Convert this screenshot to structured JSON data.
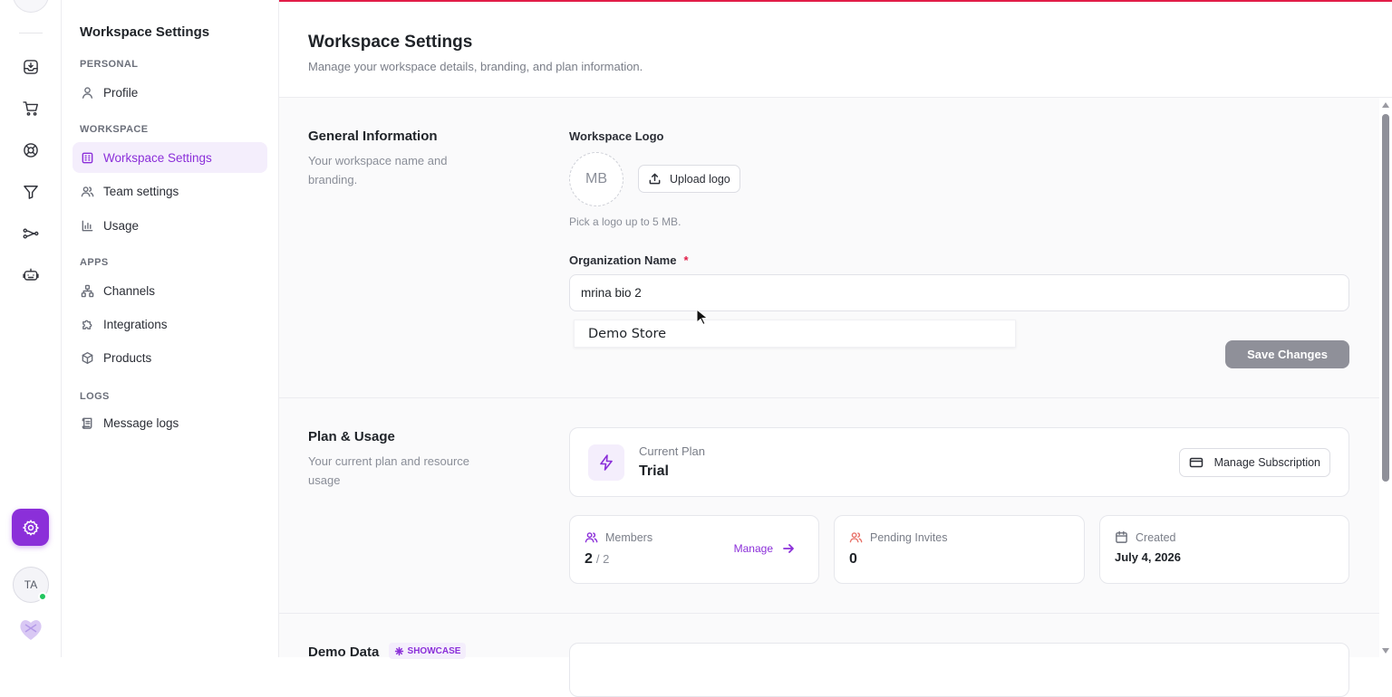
{
  "rail": {
    "icons": [
      "inbox-icon",
      "cart-icon",
      "support-icon",
      "filter-icon",
      "flow-icon",
      "bot-icon"
    ],
    "user_initials": "TA"
  },
  "sidebar": {
    "title": "Workspace Settings",
    "sections": {
      "personal": "PERSONAL",
      "workspace": "WORKSPACE",
      "apps": "APPS",
      "logs": "LOGS"
    },
    "items": {
      "profile": "Profile",
      "workspace_settings": "Workspace Settings",
      "team_settings": "Team settings",
      "usage": "Usage",
      "channels": "Channels",
      "integrations": "Integrations",
      "products": "Products",
      "message_logs": "Message logs"
    },
    "active": "workspace_settings"
  },
  "header": {
    "title": "Workspace Settings",
    "subtitle": "Manage your workspace details, branding, and plan information."
  },
  "general": {
    "title": "General Information",
    "description": "Your workspace name and branding.",
    "logo_label": "Workspace Logo",
    "logo_initials": "MB",
    "upload_label": "Upload logo",
    "logo_hint": "Pick a logo up to 5 MB.",
    "org_label": "Organization Name",
    "required_mark": "*",
    "org_value": "mrina bio 2",
    "autocomplete_suggestion": "Demo Store",
    "save_label": "Save Changes"
  },
  "plan": {
    "title": "Plan & Usage",
    "description": "Your current plan and resource usage",
    "current_plan_label": "Current Plan",
    "current_plan_value": "Trial",
    "manage_subscription_label": "Manage Subscription",
    "members_label": "Members",
    "members_count": "2",
    "members_limit": "/ 2",
    "manage_label": "Manage",
    "pending_label": "Pending Invites",
    "pending_count": "0",
    "created_label": "Created",
    "created_value": "July 4, 2026"
  },
  "demo": {
    "title": "Demo Data",
    "badge": "SHOWCASE"
  },
  "colors": {
    "accent": "#8b2fd9",
    "accent_soft": "#f4eefc",
    "top_line": "#e11d48",
    "save_disabled": "#8f9099",
    "online": "#22c55e"
  }
}
